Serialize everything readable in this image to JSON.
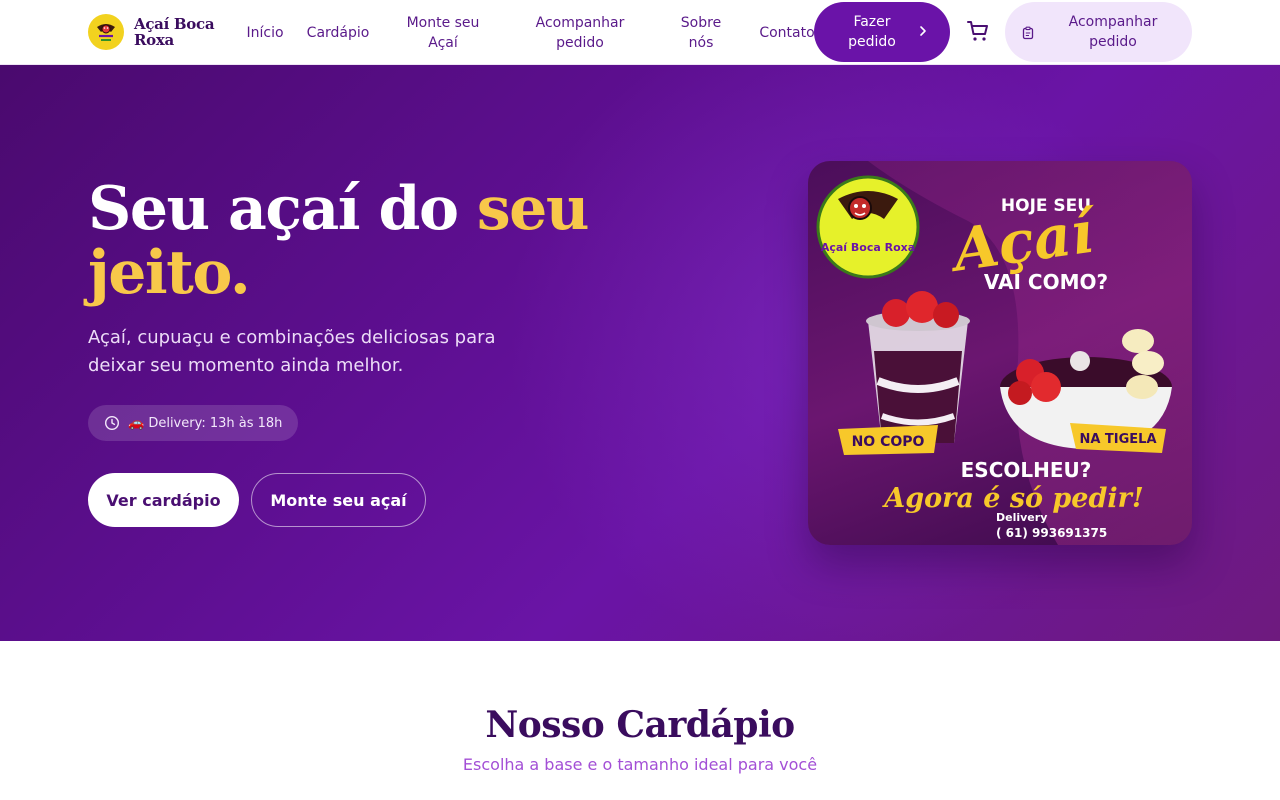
{
  "brand": {
    "name": "Açaí Boca Roxa"
  },
  "nav": {
    "links": [
      {
        "lines": [
          "Início"
        ]
      },
      {
        "lines": [
          "Cardápio"
        ]
      },
      {
        "lines": [
          "Monte seu",
          "Açaí"
        ]
      },
      {
        "lines": [
          "Acompanhar",
          "pedido"
        ]
      },
      {
        "lines": [
          "Sobre",
          "nós"
        ]
      },
      {
        "lines": [
          "Contato"
        ]
      }
    ],
    "order_button": [
      "Fazer",
      "pedido"
    ],
    "track_button": [
      "Acompanhar",
      "pedido"
    ],
    "icons": {
      "cart": "shopping-cart-icon",
      "track": "clipboard-icon",
      "chevron": "chevron-right-icon"
    }
  },
  "hero": {
    "title_part1": "Seu açaí do ",
    "title_highlight": "seu jeito.",
    "subtitle": "Açaí, cupuaçu e combinações deliciosas para deixar seu momento ainda melhor.",
    "delivery_pill": "🚗 Delivery: 13h às 18h",
    "cta_primary": "Ver cardápio",
    "cta_secondary": "Monte seu açaí"
  },
  "promo": {
    "line1": "HOJE SEU",
    "line2": "Açaí",
    "line3": "VAI COMO?",
    "badge_cup": "NO COPO",
    "badge_bowl": "NA TIGELA",
    "line4": "ESCOLHEU?",
    "line5": "Agora é só pedir!",
    "delivery_label": "Delivery",
    "phone": "( 61) 993691375",
    "logo_text": "Açaí Boca Roxa"
  },
  "menu_section": {
    "title": "Nosso Cardápio",
    "subtitle": "Escolha a base e o tamanho ideal para você"
  },
  "colors": {
    "primary": "#6a13a8",
    "accent": "#f8c84a",
    "hero_bg": "#5e0f92",
    "heading": "#3a0c5e",
    "subtle": "#a34fd6"
  }
}
